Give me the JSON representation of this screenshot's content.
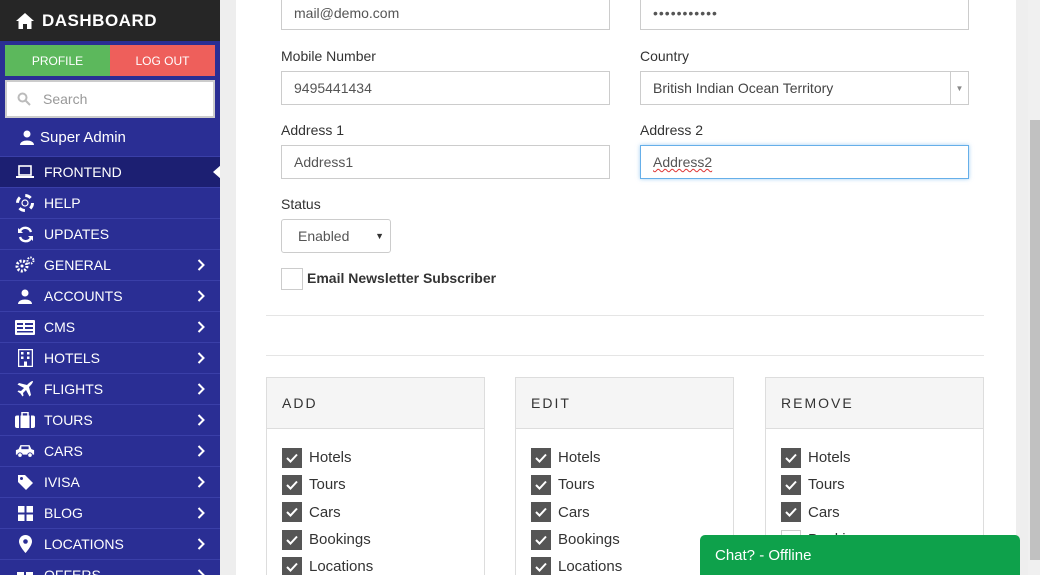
{
  "sidebar": {
    "brand": "DASHBOARD",
    "profile_label": "PROFILE",
    "logout_label": "LOG OUT",
    "search_placeholder": "Search",
    "user_name": "Super Admin",
    "items": [
      {
        "label": "FRONTEND",
        "icon": "laptop-icon",
        "active": true,
        "has_submenu": false
      },
      {
        "label": "HELP",
        "icon": "lifebuoy-icon",
        "active": false,
        "has_submenu": false
      },
      {
        "label": "UPDATES",
        "icon": "refresh-icon",
        "active": false,
        "has_submenu": false
      },
      {
        "label": "GENERAL",
        "icon": "gears-icon",
        "active": false,
        "has_submenu": true
      },
      {
        "label": "ACCOUNTS",
        "icon": "user-icon",
        "active": false,
        "has_submenu": true
      },
      {
        "label": "CMS",
        "icon": "cms-icon",
        "active": false,
        "has_submenu": true
      },
      {
        "label": "HOTELS",
        "icon": "building-icon",
        "active": false,
        "has_submenu": true
      },
      {
        "label": "FLIGHTS",
        "icon": "plane-icon",
        "active": false,
        "has_submenu": true
      },
      {
        "label": "TOURS",
        "icon": "suitcase-icon",
        "active": false,
        "has_submenu": true
      },
      {
        "label": "CARS",
        "icon": "car-icon",
        "active": false,
        "has_submenu": true
      },
      {
        "label": "IVISA",
        "icon": "tag-icon",
        "active": false,
        "has_submenu": true
      },
      {
        "label": "BLOG",
        "icon": "grid-icon",
        "active": false,
        "has_submenu": true
      },
      {
        "label": "LOCATIONS",
        "icon": "map-marker-icon",
        "active": false,
        "has_submenu": true
      },
      {
        "label": "OFFERS",
        "icon": "gift-icon",
        "active": false,
        "has_submenu": true
      }
    ],
    "colors": {
      "background": "#2a2e94",
      "brand_bar": "#262626",
      "profile": "#5cb85c",
      "logout": "#ee5f5b"
    }
  },
  "form": {
    "email_value": "mail@demo.com",
    "password_value": "•••••••••••",
    "mobile_label": "Mobile Number",
    "mobile_value": "9495441434",
    "country_label": "Country",
    "country_value": "British Indian Ocean Territory",
    "address1_label": "Address 1",
    "address1_value": "Address1",
    "address2_label": "Address 2",
    "address2_value": "Address2",
    "status_label": "Status",
    "status_value": "Enabled",
    "newsletter_label": "Email Newsletter Subscriber",
    "newsletter_checked": false
  },
  "permissions": {
    "panels": [
      {
        "title": "ADD",
        "items": [
          {
            "label": "Hotels",
            "checked": true
          },
          {
            "label": "Tours",
            "checked": true
          },
          {
            "label": "Cars",
            "checked": true
          },
          {
            "label": "Bookings",
            "checked": true
          },
          {
            "label": "Locations",
            "checked": true
          }
        ]
      },
      {
        "title": "EDIT",
        "items": [
          {
            "label": "Hotels",
            "checked": true
          },
          {
            "label": "Tours",
            "checked": true
          },
          {
            "label": "Cars",
            "checked": true
          },
          {
            "label": "Bookings",
            "checked": true
          },
          {
            "label": "Locations",
            "checked": true
          }
        ]
      },
      {
        "title": "REMOVE",
        "items": [
          {
            "label": "Hotels",
            "checked": true
          },
          {
            "label": "Tours",
            "checked": true
          },
          {
            "label": "Cars",
            "checked": true
          },
          {
            "label": "Bookings",
            "checked": false
          }
        ]
      }
    ]
  },
  "chat": {
    "label": "Chat? - Offline",
    "color": "#0ea14b"
  }
}
